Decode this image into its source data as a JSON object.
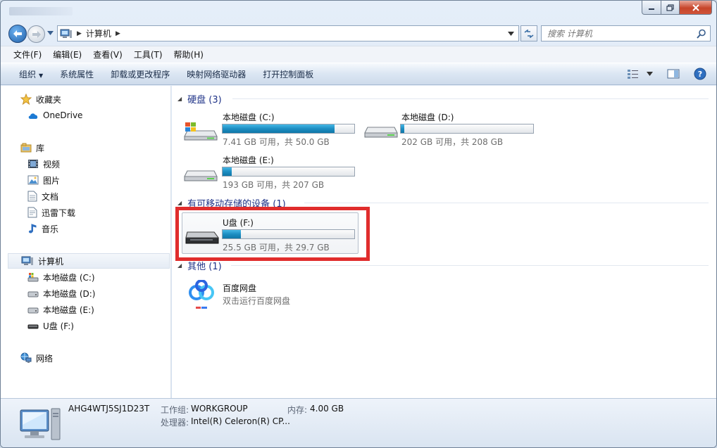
{
  "window": {
    "title": ""
  },
  "address": {
    "segment": "计算机"
  },
  "search": {
    "placeholder": "搜索 计算机"
  },
  "menu": [
    "文件(F)",
    "编辑(E)",
    "查看(V)",
    "工具(T)",
    "帮助(H)"
  ],
  "commands": {
    "organize": "组织",
    "items": [
      "系统属性",
      "卸载或更改程序",
      "映射网络驱动器",
      "打开控制面板"
    ]
  },
  "nav": {
    "favorites": "收藏夹",
    "onedrive": "OneDrive",
    "libraries": "库",
    "videos": "视频",
    "pictures": "图片",
    "documents": "文档",
    "xunlei": "迅雷下载",
    "music": "音乐",
    "computer": "计算机",
    "drive_c": "本地磁盘 (C:)",
    "drive_d": "本地磁盘 (D:)",
    "drive_e": "本地磁盘 (E:)",
    "drive_f": "U盘 (F:)",
    "network": "网络"
  },
  "groups": {
    "hdd": "硬盘 (3)",
    "removable": "有可移动存储的设备 (1)",
    "other": "其他 (1)"
  },
  "drives": [
    {
      "name": "本地磁盘 (C:)",
      "free": "7.41 GB 可用，共 50.0 GB",
      "used_fraction": 0.852
    },
    {
      "name": "本地磁盘 (D:)",
      "free": "202 GB 可用，共 208 GB",
      "used_fraction": 0.029
    },
    {
      "name": "本地磁盘 (E:)",
      "free": "193 GB 可用，共 207 GB",
      "used_fraction": 0.068
    },
    {
      "name": "U盘 (F:)",
      "free": "25.5 GB 可用，共 29.7 GB",
      "used_fraction": 0.141
    }
  ],
  "other": {
    "name": "百度网盘",
    "desc": "双击运行百度网盘"
  },
  "details": {
    "computer_name": "AHG4WTJ5SJ1D23T",
    "workgroup_label": "工作组:",
    "workgroup": "WORKGROUP",
    "memory_label": "内存:",
    "memory": "4.00 GB",
    "cpu_label": "处理器:",
    "cpu": "Intel(R) Celeron(R) CP..."
  },
  "colors": {
    "bar_fill": "#1d8ec2",
    "highlight": "#e02d2d",
    "group_head": "#1e3287"
  }
}
